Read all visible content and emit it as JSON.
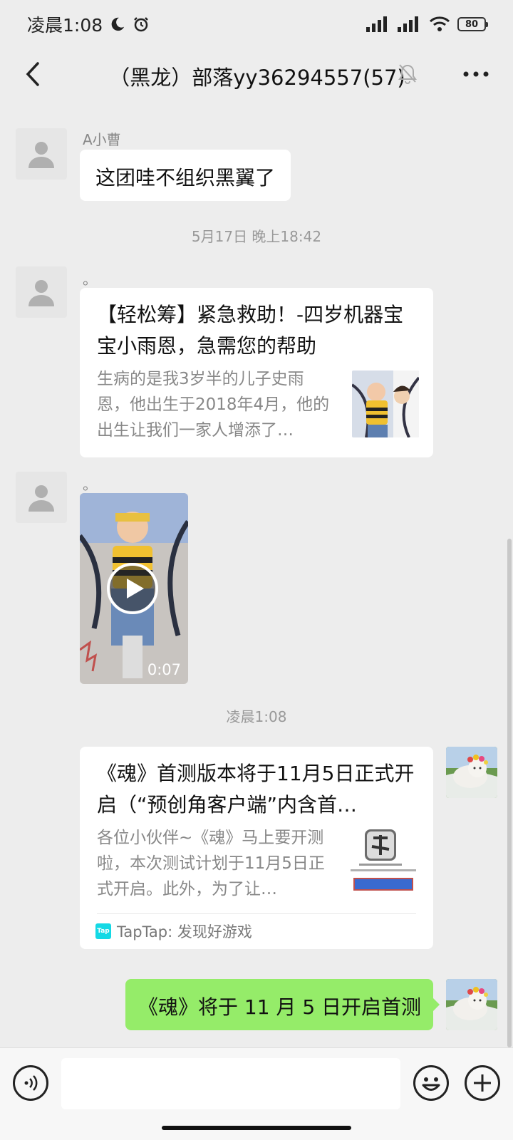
{
  "status": {
    "time": "凌晨1:08",
    "battery": "80"
  },
  "header": {
    "title": "（黑龙）部落yy36294557(57)"
  },
  "messages": {
    "m1": {
      "sender": "A小曹",
      "text": "这团哇不组织黑翼了"
    },
    "ts1": "5月17日 晚上18:42",
    "m2": {
      "sender": "。",
      "title": "【轻松筹】紧急救助！-四岁机器宝宝小雨恩，急需您的帮助",
      "desc": "生病的是我3岁半的儿子史雨恩，他出生于2018年4月，他的出生让我们一家人增添了…"
    },
    "m3": {
      "sender": "。",
      "duration": "0:07"
    },
    "ts2": "凌晨1:08",
    "m4": {
      "title": "《魂》首测版本将于11月5日正式开启（“预创角客户端”内含首…",
      "desc": "各位小伙伴~《魂》马上要开测啦，本次测试计划于11月5日正式开启。此外，为了让…",
      "source": "TapTap: 发现好游戏",
      "source_icon": "Tap"
    },
    "m5": {
      "text": "《魂》将于 11 月 5 日开启首测"
    }
  },
  "colors": {
    "my_bubble": "#95ec69",
    "background": "#ededed",
    "taptap": "#14d9e5"
  }
}
